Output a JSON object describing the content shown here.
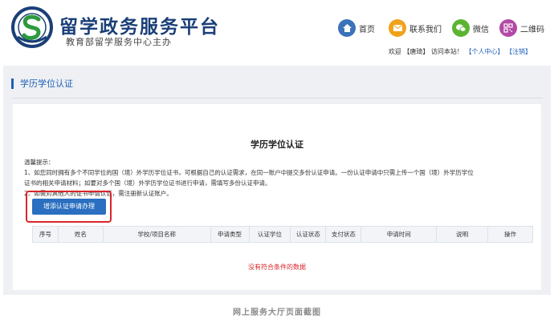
{
  "header": {
    "title": "留学政务服务平台",
    "subtitle": "教育部留学服务中心主办",
    "nav": [
      {
        "icon": "home-icon",
        "label": "首页",
        "color": "#3b73b9"
      },
      {
        "icon": "mail-icon",
        "label": "联系我们",
        "color": "#f0a21b"
      },
      {
        "icon": "wechat-icon",
        "label": "微信",
        "color": "#5cb531"
      },
      {
        "icon": "qrcode-icon",
        "label": "二维码",
        "color": "#b24aa6"
      }
    ],
    "welcome": {
      "prefix": "欢迎 【",
      "user": "唐琦",
      "middle": "】 访问本站！",
      "personal_center": "【个人中心】",
      "logout": "【注销】"
    }
  },
  "section": {
    "title": "学历学位认证"
  },
  "card": {
    "title": "学历学位认证",
    "notes": [
      "温馨提示：",
      "1、如您同时拥有多个不同学位的国（境）外学历学位证书，可根据自己的认证需求，在同一账户中提交多份认证申请。一份认证申请中只需上传一个国（境）外学历学位",
      "证书的相关申请材料；如要对多个国（境）外学历学位证书进行申请，需填写多份认证申请。",
      "2、如需对其他人的证书申请认证，需注册新认证账户。"
    ],
    "add_button": "增添认证申请办理",
    "table_headers": [
      "序号",
      "姓名",
      "学校/项目名称",
      "申请类型",
      "认证学位",
      "认证状态",
      "支付状态",
      "申请时间",
      "说明",
      "操作"
    ],
    "empty_message": "没有符合条件的数据"
  },
  "caption": "网上服务大厅页面截图",
  "colors": {
    "brand": "#1a3f78",
    "link": "#1f5fb8",
    "button": "#2a6fc0",
    "highlight": "#d9252b"
  }
}
